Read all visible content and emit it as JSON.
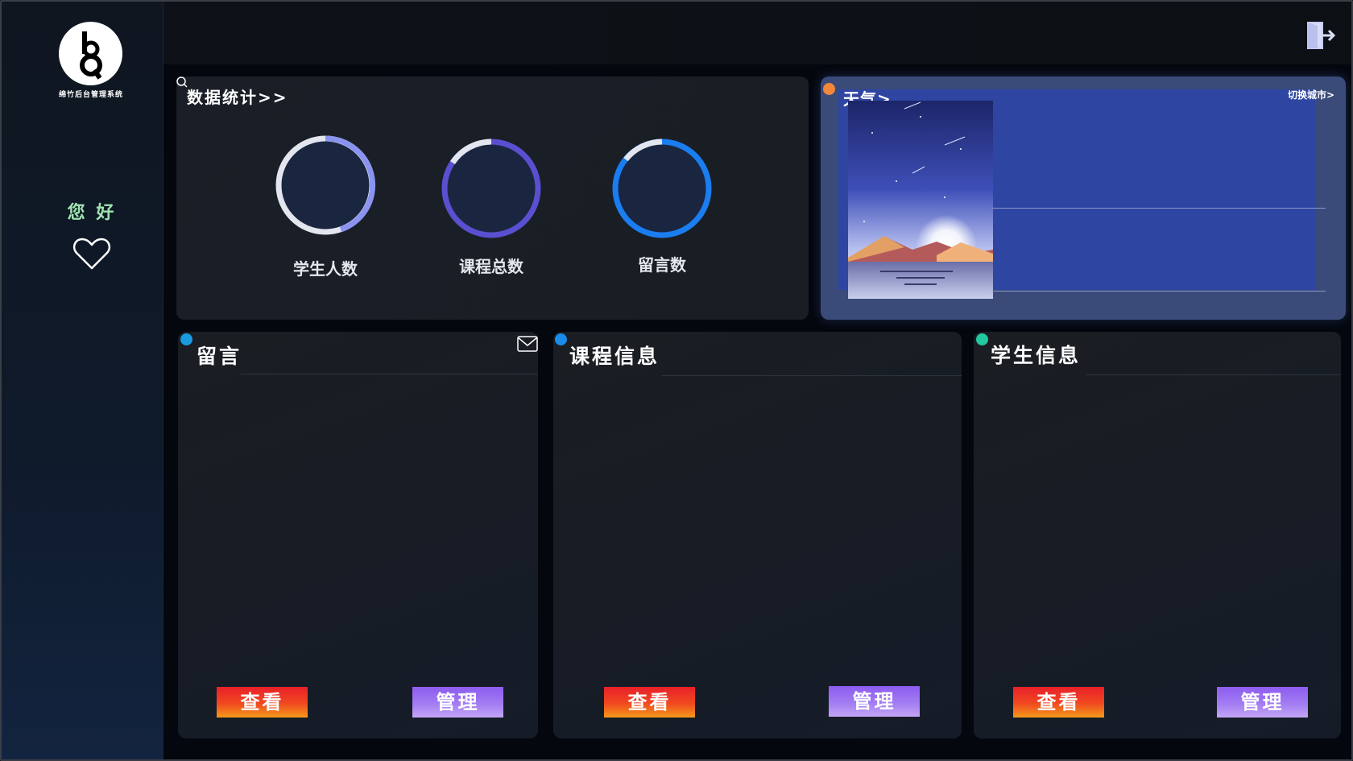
{
  "sidebar": {
    "logo_caption": "绵竹后台管理系统",
    "greeting": "您 好"
  },
  "stats": {
    "title": "数据统计>>",
    "items": [
      {
        "label": "学生人数"
      },
      {
        "label": "课程总数"
      },
      {
        "label": "留言数"
      }
    ]
  },
  "weather": {
    "title": "天气>",
    "switch_city": "切换城市>"
  },
  "cards": [
    {
      "title": "留言",
      "view_label": "查看",
      "manage_label": "管理",
      "dot_color": "#1a9be0"
    },
    {
      "title": "课程信息",
      "view_label": "查看",
      "manage_label": "管理",
      "dot_color": "#1a8be8"
    },
    {
      "title": "学生信息",
      "view_label": "查看",
      "manage_label": "管理",
      "dot_color": "#22c9a0"
    }
  ],
  "colors": {
    "weather_dot": "#f4873a",
    "ring_student": "#8a94f0",
    "ring_course": "#5a4fd0",
    "ring_message": "#1a7df0"
  },
  "icons": {
    "logout": "logout-icon",
    "heart": "heart-icon",
    "search": "search-icon",
    "mail": "mail-icon"
  }
}
